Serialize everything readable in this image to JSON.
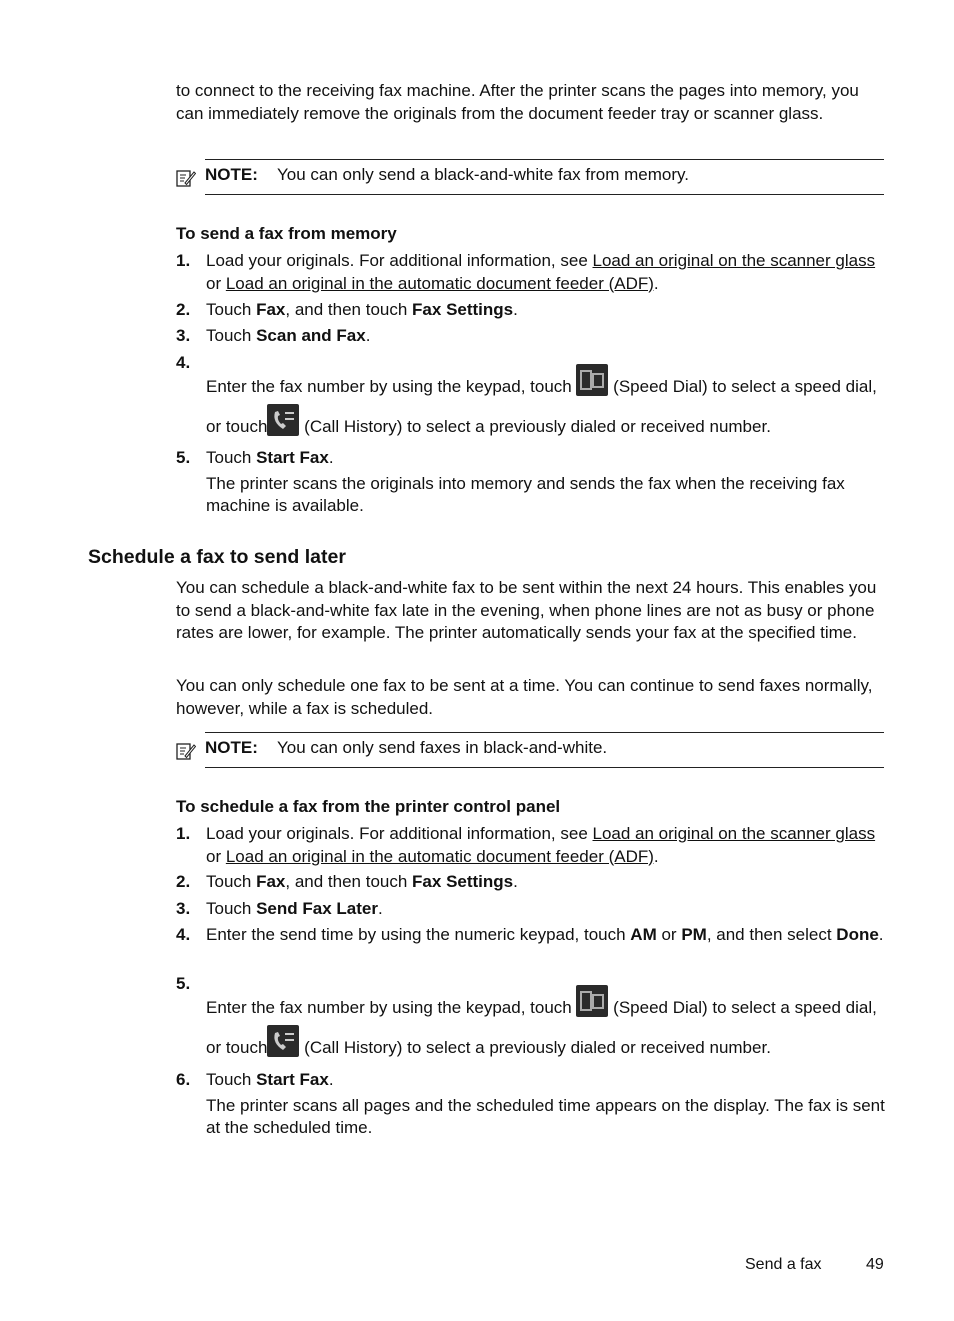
{
  "intro": "to connect to the receiving fax machine. After the printer scans the pages into memory, you can immediately remove the originals from the document feeder tray or scanner glass.",
  "note1": {
    "label": "NOTE:",
    "text": "You can only send a black-and-white fax from memory."
  },
  "proc1": {
    "title": "To send a fax from memory",
    "steps": [
      {
        "num": "1.",
        "pre": "Load your originals. For additional information, see ",
        "link1": "Load an original on the scanner glass",
        "mid": " or ",
        "link2": "Load an original in the automatic document feeder (ADF)",
        "post": "."
      },
      {
        "num": "2.",
        "a": "Touch ",
        "b1": "Fax",
        "c": ", and then touch ",
        "b2": "Fax Settings",
        "d": "."
      },
      {
        "num": "3.",
        "a": "Touch ",
        "b1": "Scan and Fax",
        "d": "."
      },
      {
        "num": "4.",
        "a": "Enter the fax number by using the keypad, touch ",
        "b": " (Speed Dial) to select a speed dial, or touch",
        "c": " (Call History) to select a previously dialed or received number."
      },
      {
        "num": "5.",
        "a": "Touch ",
        "b1": "Start Fax",
        "d": ".",
        "extra": "The printer scans the originals into memory and sends the fax when the receiving fax machine is available."
      }
    ]
  },
  "section": {
    "title": "Schedule a fax to send later",
    "para1": "You can schedule a black-and-white fax to be sent within the next 24 hours. This enables you to send a black-and-white fax late in the evening, when phone lines are not as busy or phone rates are lower, for example. The printer automatically sends your fax at the specified time.",
    "para2": "You can only schedule one fax to be sent at a time. You can continue to send faxes normally, however, while a fax is scheduled."
  },
  "note2": {
    "label": "NOTE:",
    "text": "You can only send faxes in black-and-white."
  },
  "proc2": {
    "title": "To schedule a fax from the printer control panel",
    "steps": [
      {
        "num": "1.",
        "pre": "Load your originals. For additional information, see ",
        "link1": "Load an original on the scanner glass",
        "mid": " or ",
        "link2": "Load an original in the automatic document feeder (ADF)",
        "post": "."
      },
      {
        "num": "2.",
        "a": "Touch ",
        "b1": "Fax",
        "c": ", and then touch ",
        "b2": "Fax Settings",
        "d": "."
      },
      {
        "num": "3.",
        "a": "Touch ",
        "b1": "Send Fax Later",
        "d": "."
      },
      {
        "num": "4.",
        "a": "Enter the send time by using the numeric keypad, touch ",
        "b1": "AM",
        "c": " or ",
        "b2": "PM",
        "c2": ", and then select ",
        "b3": "Done",
        "d": "."
      },
      {
        "num": "5.",
        "a": "Enter the fax number by using the keypad, touch ",
        "b": " (Speed Dial) to select a speed dial, or touch",
        "c": " (Call History) to select a previously dialed or received number."
      },
      {
        "num": "6.",
        "a": "Touch ",
        "b1": "Start Fax",
        "d": ".",
        "extra": "The printer scans all pages and the scheduled time appears on the display. The fax is sent at the scheduled time."
      }
    ]
  },
  "footer": {
    "section": "Send a fax",
    "page": "49"
  },
  "icons": {
    "note": "note-pencil-icon",
    "speed_dial": "speed-dial-icon",
    "call_history": "call-history-icon"
  }
}
